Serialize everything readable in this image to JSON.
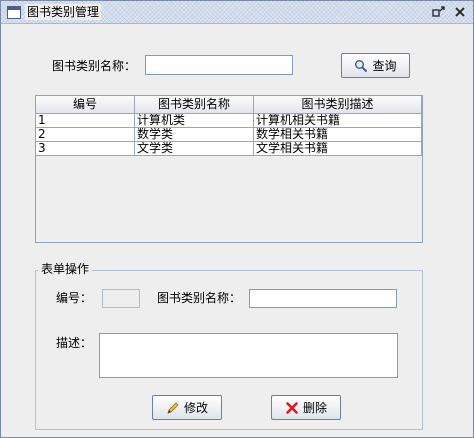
{
  "window": {
    "title": "图书类别管理",
    "accent": "#dde6f2"
  },
  "search": {
    "label": "图书类别名称：",
    "value": "",
    "button_label": "查询",
    "button_icon": "search-icon"
  },
  "table": {
    "headers": [
      "编号",
      "图书类别名称",
      "图书类别描述"
    ],
    "rows": [
      [
        "1",
        "计算机类",
        "计算机相关书籍"
      ],
      [
        "2",
        "数学类",
        "数学相关书籍"
      ],
      [
        "3",
        "文学类",
        "文学相关书籍"
      ]
    ]
  },
  "form": {
    "group_title": "表单操作",
    "id_label": "编号：",
    "id_value": "",
    "name_label": "图书类别名称：",
    "name_value": "",
    "desc_label": "描述：",
    "desc_value": "",
    "modify_label": "修改",
    "modify_icon": "pencil-icon",
    "delete_label": "删除",
    "delete_icon": "red-x-icon"
  }
}
